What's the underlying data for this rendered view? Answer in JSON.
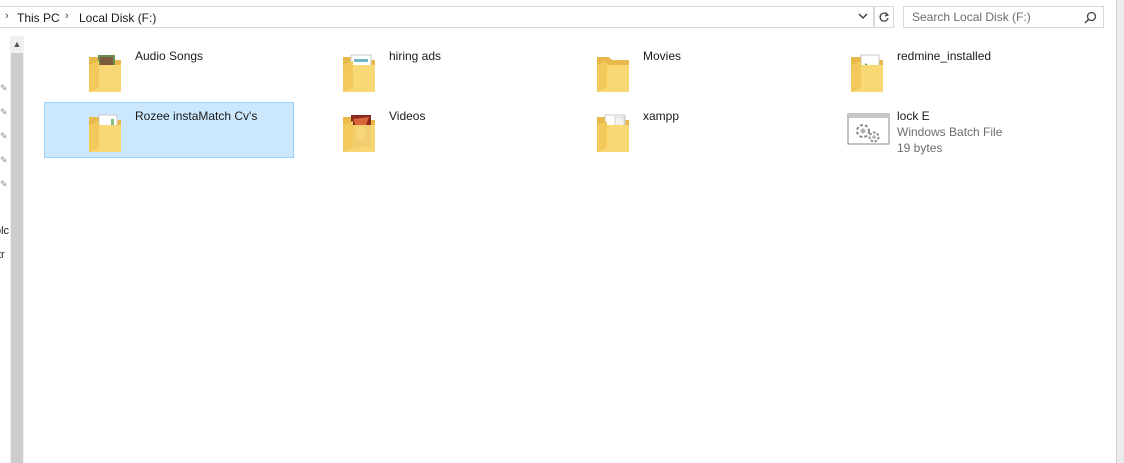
{
  "address_bar": {
    "breadcrumbs": [
      "This PC",
      "Local Disk (F:)"
    ]
  },
  "search": {
    "placeholder": "Search Local Disk (F:)"
  },
  "nav_pane": {
    "fragments": [
      "olc",
      "tr"
    ]
  },
  "items": [
    {
      "name": "Audio Songs",
      "type": "folder",
      "icon": "folder-music-icon"
    },
    {
      "name": "hiring ads",
      "type": "folder",
      "icon": "folder-document-icon"
    },
    {
      "name": "Movies",
      "type": "folder",
      "icon": "folder-icon"
    },
    {
      "name": "redmine_installed",
      "type": "folder",
      "icon": "folder-app-icon"
    },
    {
      "name": "Rozee instaMatch Cv's",
      "type": "folder",
      "icon": "folder-document-icon",
      "selected": true
    },
    {
      "name": "Videos",
      "type": "folder",
      "icon": "folder-video-icon"
    },
    {
      "name": "xampp",
      "type": "folder",
      "icon": "folder-document-icon"
    },
    {
      "name": "lock E",
      "type": "file",
      "icon": "batch-file-icon",
      "file_type": "Windows Batch File",
      "size": "19 bytes"
    }
  ],
  "colors": {
    "selection_bg": "#cce8ff",
    "selection_border": "#99d1ff",
    "folder": "#f8d775"
  }
}
